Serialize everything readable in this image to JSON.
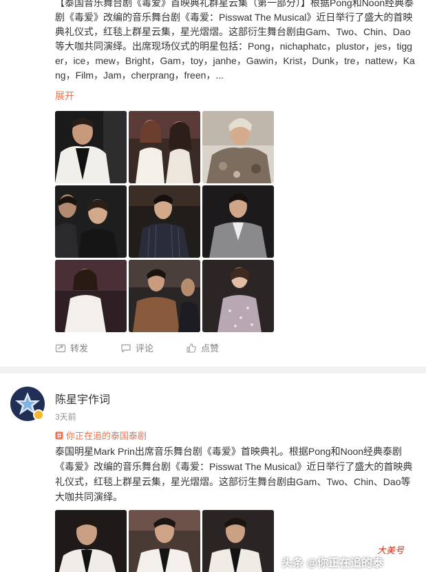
{
  "post1": {
    "text": "【泰国音乐舞台剧《毒爱》首映典礼群星云集（第一部分）】根据Pong和Noon经典泰剧《毒爱》改编的音乐舞台剧《毒爱：Pisswat The Musical》近日举行了盛大的首映典礼仪式，红毯上群星云集，星光熠熠。这部衍生舞台剧由Gam、Two、Chin、Dao等大咖共同演绎。出席现场仪式的明星包括：Pong，nichaphatc，plustor，jes，tigger，ice，mew，Bright，Gam，toy，janhe，Gawin，Krist，Dunk，tre，nattew，Kang，Film，Jam，cherprang，freen，...",
    "expand": "展开",
    "actions": {
      "repost": "转发",
      "comment": "评论",
      "like": "点赞"
    }
  },
  "post2": {
    "author": "陈星宇作词",
    "time": "3天前",
    "topic": "你正在追的泰国泰剧",
    "text": "泰国明星Mark Prin出席音乐舞台剧《毒爱》首映典礼。根据Pong和Noon经典泰剧《毒爱》改编的音乐舞台剧《毒爱：Pisswat The Musical》近日举行了盛大的首映典礼仪式，红毯上群星云集，星光熠熠。这部衍生舞台剧由Gam、Two、Chin、Dao等大咖共同演绎。"
  },
  "watermark": "头条 @你正在追的泰",
  "logo_text": "大美号",
  "colors": {
    "accent": "#eb7350",
    "muted": "#808080",
    "divider": "#f2f2f2",
    "verified": "#f8b62d"
  },
  "icons": {
    "repost": "repost-icon",
    "comment": "comment-icon",
    "like": "like-icon",
    "topic": "topic-icon"
  }
}
